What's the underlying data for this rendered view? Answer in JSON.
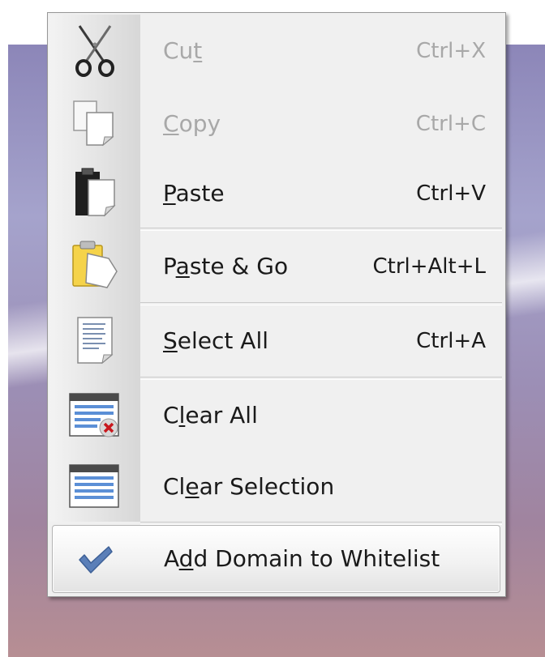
{
  "menu": {
    "items": [
      {
        "label_pre": "Cu",
        "label_mn": "t",
        "label_post": "",
        "shortcut": "Ctrl+X",
        "icon": "scissors-icon",
        "enabled": false
      },
      {
        "label_pre": "",
        "label_mn": "C",
        "label_post": "opy",
        "shortcut": "Ctrl+C",
        "icon": "copy-pages-icon",
        "enabled": false
      },
      {
        "label_pre": "",
        "label_mn": "P",
        "label_post": "aste",
        "shortcut": "Ctrl+V",
        "icon": "clipboard-icon",
        "enabled": true
      },
      {
        "label_pre": "P",
        "label_mn": "a",
        "label_post": "ste & Go",
        "shortcut": "Ctrl+Alt+L",
        "icon": "paste-go-icon",
        "enabled": true
      },
      {
        "label_pre": "",
        "label_mn": "S",
        "label_post": "elect All",
        "shortcut": "Ctrl+A",
        "icon": "document-icon",
        "enabled": true
      },
      {
        "label_pre": "C",
        "label_mn": "l",
        "label_post": "ear All",
        "shortcut": "",
        "icon": "clear-window-icon",
        "enabled": true
      },
      {
        "label_pre": "Cl",
        "label_mn": "e",
        "label_post": "ar Selection",
        "shortcut": "",
        "icon": "window-list-icon",
        "enabled": true
      },
      {
        "label_pre": "A",
        "label_mn": "d",
        "label_post": "d Domain to Whitelist",
        "shortcut": "",
        "icon": "checkmark-icon",
        "enabled": true,
        "highlighted": true
      }
    ]
  }
}
